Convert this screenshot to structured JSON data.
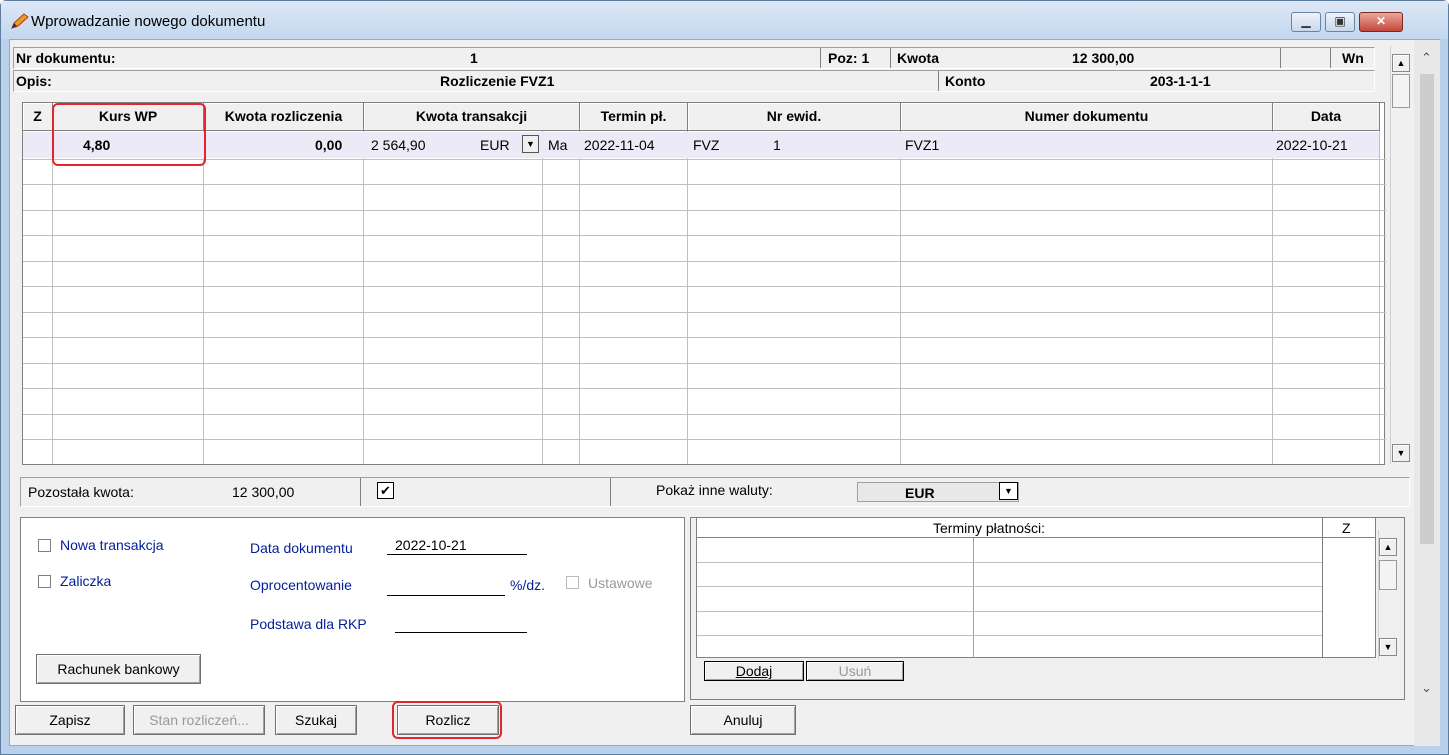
{
  "window": {
    "title": "Wprowadzanie nowego dokumentu"
  },
  "header": {
    "nr_label": "Nr dokumentu:",
    "nr_value": "1",
    "poz_label": "Poz: 1",
    "kwota_label": "Kwota",
    "kwota_value": "12 300,00",
    "side": "Wn",
    "opis_label": "Opis:",
    "opis_value": "Rozliczenie FVZ1",
    "konto_label": "Konto",
    "konto_value": "203-1-1-1"
  },
  "grid": {
    "columns": [
      "Z",
      "Kurs WP",
      "Kwota rozliczenia",
      "Kwota transakcji",
      "Termin pł.",
      "Nr ewid.",
      "Numer dokumentu",
      "Data"
    ],
    "row": {
      "kurs": "4,80",
      "kwota_rozl": "0,00",
      "kwota_trans": "2 564,90",
      "waluta": "EUR",
      "strona": "Ma",
      "termin": "2022-11-04",
      "nr_ewid_a": "FVZ",
      "nr_ewid_b": "1",
      "numer": "FVZ1",
      "data": "2022-10-21"
    }
  },
  "status": {
    "pozostala_label": "Pozostała kwota:",
    "pozostala_value": "12 300,00",
    "check_mark": "✔",
    "inne_label": "Pokaż inne waluty:",
    "waluta": "EUR"
  },
  "form": {
    "nowa_transakcja": "Nowa transakcja",
    "zaliczka": "Zaliczka",
    "data_dok_label": "Data dokumentu",
    "data_dok_value": "2022-10-21",
    "oprocentowanie_label": "Oprocentowanie",
    "unit": "%/dz.",
    "ustawowe": "Ustawowe",
    "podstawa_label": "Podstawa dla RKP",
    "rachunek_button": "Rachunek bankowy"
  },
  "terms": {
    "title": "Terminy płatności:",
    "z": "Z",
    "dodaj": "Dodaj",
    "usun": "Usuń"
  },
  "buttons": {
    "zapisz": "Zapisz",
    "stan": "Stan rozliczeń...",
    "szukaj": "Szukaj",
    "rozlicz": "Rozlicz",
    "anuluj": "Anuluj"
  }
}
